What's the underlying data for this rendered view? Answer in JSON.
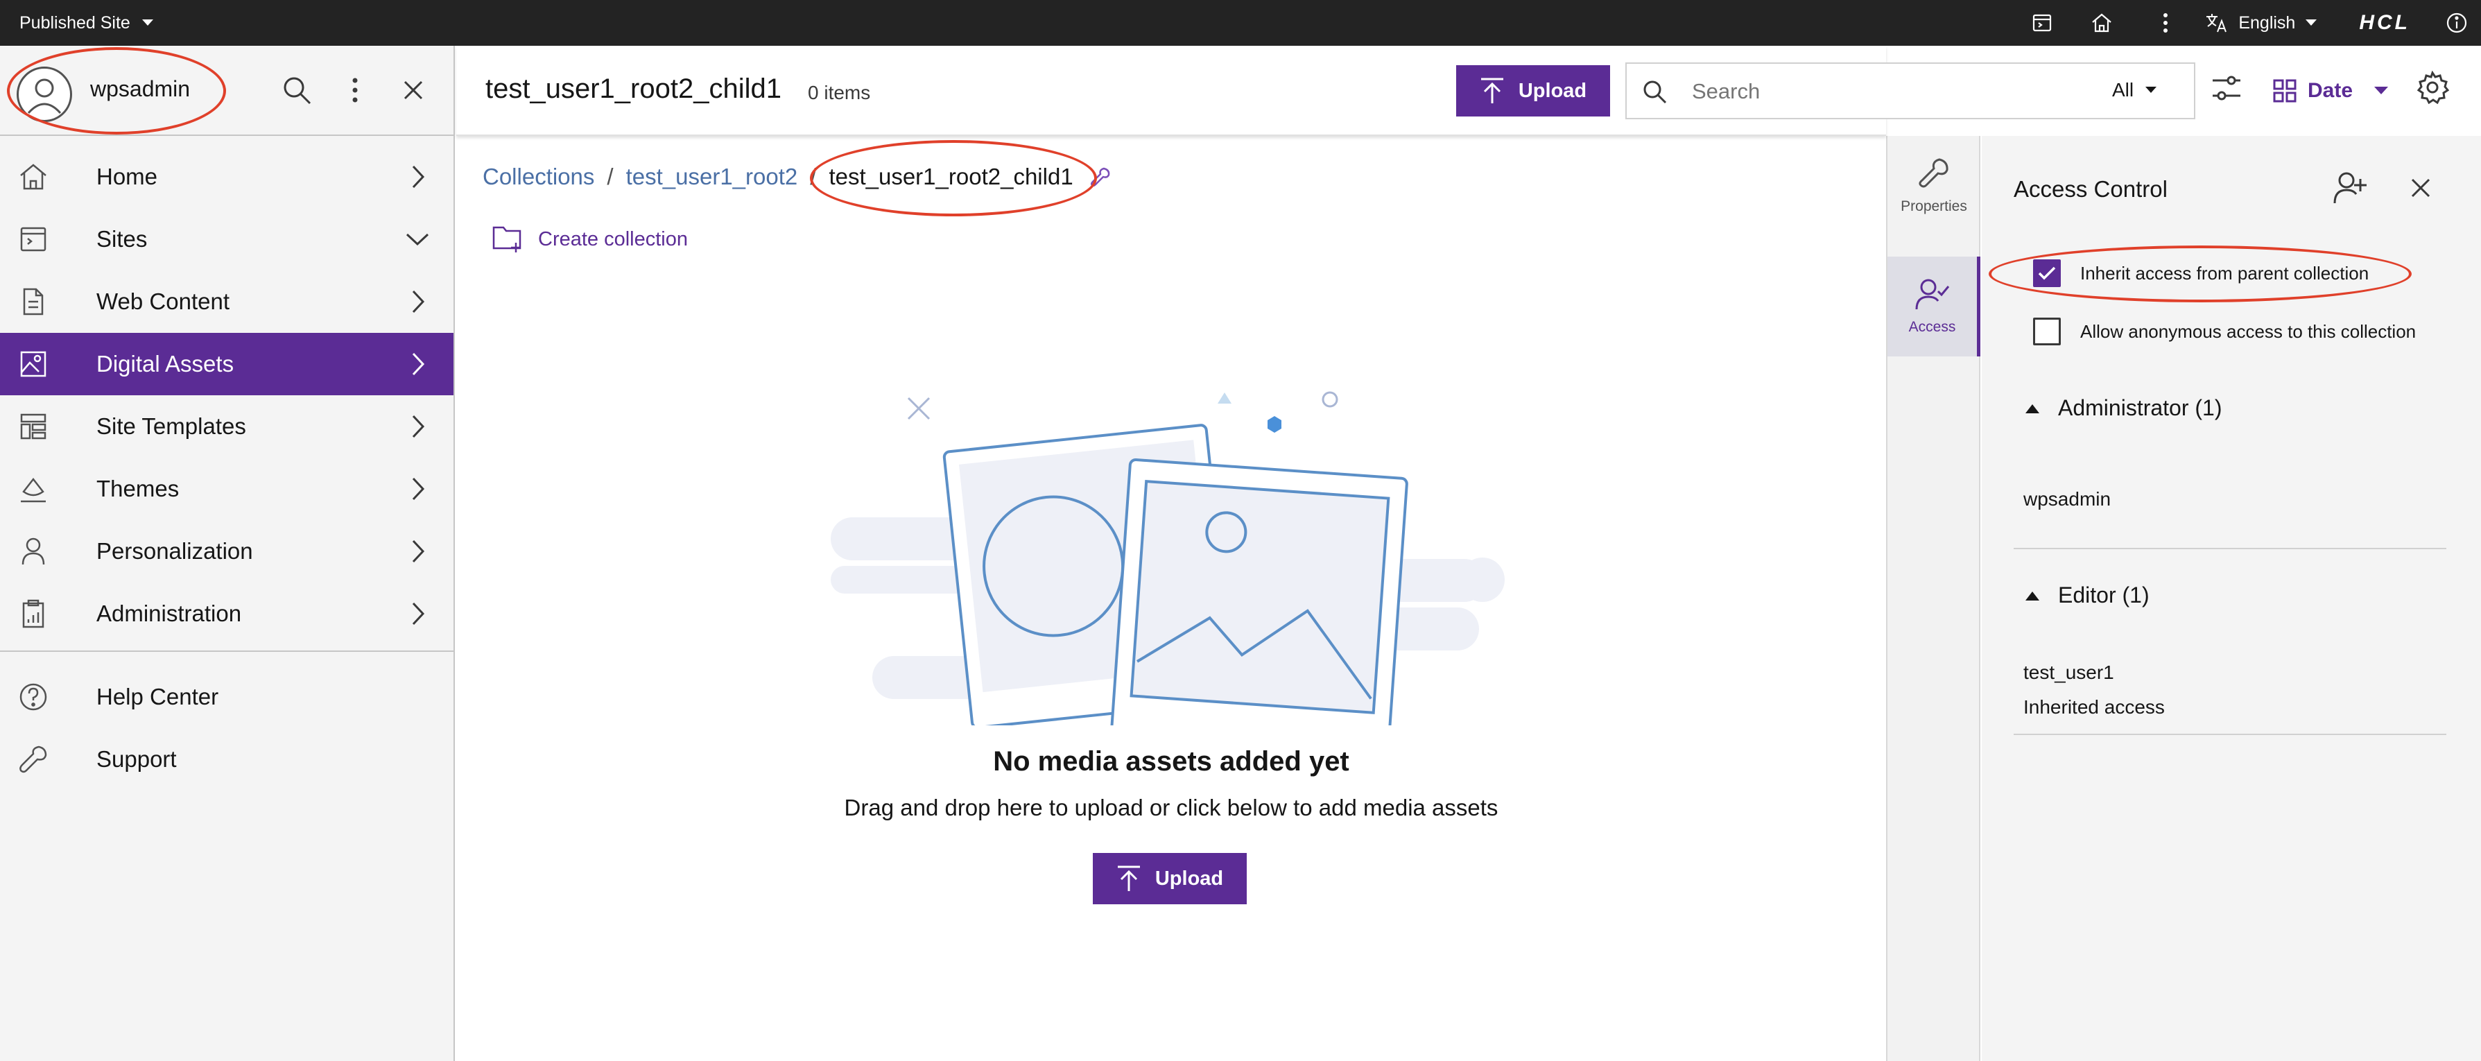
{
  "topbar": {
    "site_label": "Published Site",
    "language": "English",
    "brand": "HCL",
    "icons": [
      "preview-icon",
      "home-icon",
      "overflow-menu-icon",
      "translate-icon",
      "info-icon"
    ]
  },
  "sidebar": {
    "user": "wpsadmin",
    "items": [
      {
        "label": "Home",
        "icon": "home-icon",
        "chevron": "right"
      },
      {
        "label": "Sites",
        "icon": "sites-icon",
        "chevron": "down"
      },
      {
        "label": "Web Content",
        "icon": "document-icon",
        "chevron": "right"
      },
      {
        "label": "Digital Assets",
        "icon": "image-icon",
        "chevron": "right",
        "active": true
      },
      {
        "label": "Site Templates",
        "icon": "template-icon",
        "chevron": "right"
      },
      {
        "label": "Themes",
        "icon": "paint-icon",
        "chevron": "right"
      },
      {
        "label": "Personalization",
        "icon": "user-icon",
        "chevron": "right"
      },
      {
        "label": "Administration",
        "icon": "clipboard-icon",
        "chevron": "right"
      }
    ],
    "footer_items": [
      {
        "label": "Help Center",
        "icon": "help-icon"
      },
      {
        "label": "Support",
        "icon": "wrench-icon"
      }
    ]
  },
  "header": {
    "title": "test_user1_root2_child1",
    "item_count": "0 items",
    "upload_label": "Upload",
    "search_placeholder": "Search",
    "filter_value": "All",
    "sort_value": "Date"
  },
  "breadcrumb": {
    "items": [
      "Collections",
      "test_user1_root2",
      "test_user1_root2_child1"
    ],
    "separator": "/"
  },
  "create_collection_label": "Create collection",
  "empty_state": {
    "title": "No media assets added yet",
    "subtitle": "Drag and drop here to upload or click below to add media assets",
    "upload_label": "Upload"
  },
  "rail": {
    "properties_label": "Properties",
    "access_label": "Access"
  },
  "access_panel": {
    "title": "Access Control",
    "inherit_label": "Inherit access from parent collection",
    "inherit_checked": true,
    "anonymous_label": "Allow anonymous access to this collection",
    "anonymous_checked": false,
    "groups": [
      {
        "name": "Administrator (1)",
        "members": [
          "wpsadmin"
        ]
      },
      {
        "name": "Editor (1)",
        "members": [
          "test_user1"
        ],
        "note": "Inherited access"
      }
    ]
  },
  "colors": {
    "accent": "#5b2c95",
    "annotation": "#e0402a",
    "topbar": "#232323"
  }
}
